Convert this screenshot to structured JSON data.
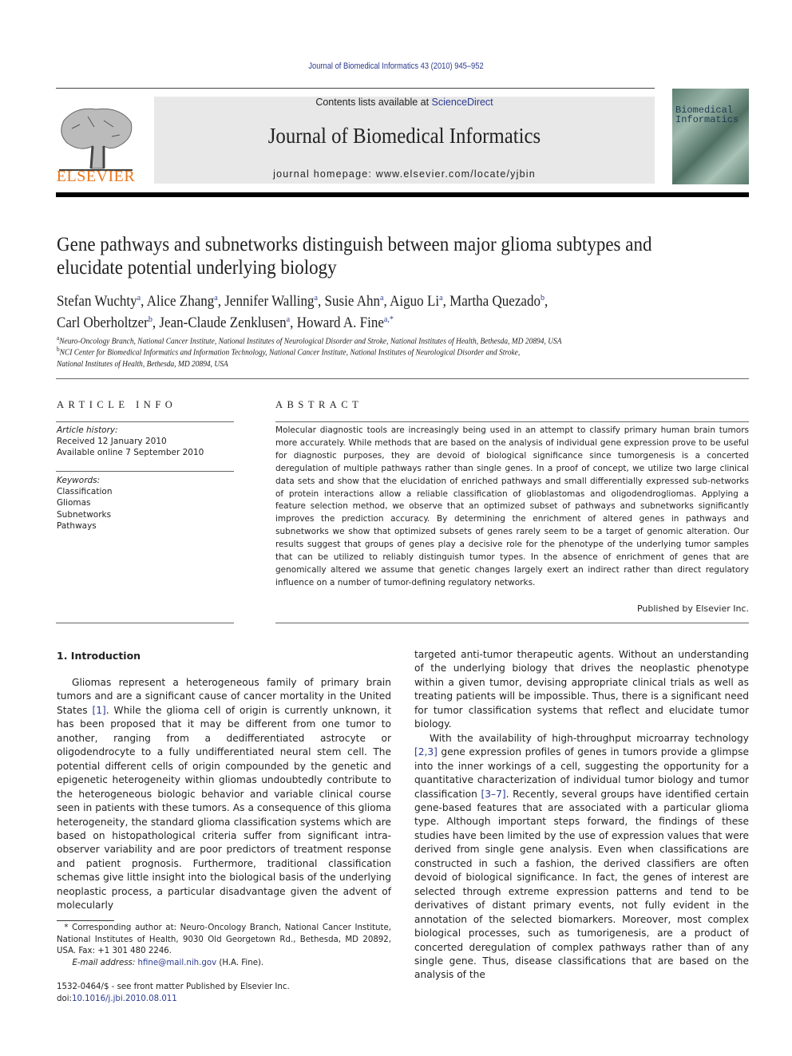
{
  "running_head": "Journal of Biomedical Informatics 43 (2010) 945–952",
  "header": {
    "contents_prefix": "Contents lists available at ",
    "contents_link": "ScienceDirect",
    "journal_title": "Journal of Biomedical Informatics",
    "homepage": "journal homepage: www.elsevier.com/locate/yjbin",
    "publisher_logo_text": "ELSEVIER",
    "cover_text": "Biomedical Informatics",
    "colors": {
      "elsevier_orange": "#e8771e",
      "link_blue": "#2b3a8f",
      "band_gray": "#e8e8e8"
    }
  },
  "article": {
    "title": "Gene pathways and subnetworks distinguish between major glioma subtypes and elucidate potential underlying biology",
    "authors": [
      {
        "name": "Stefan Wuchty",
        "aff": "a"
      },
      {
        "name": "Alice Zhang",
        "aff": "a"
      },
      {
        "name": "Jennifer Walling",
        "aff": "a"
      },
      {
        "name": "Susie Ahn",
        "aff": "a"
      },
      {
        "name": "Aiguo Li",
        "aff": "a"
      },
      {
        "name": "Martha Quezado",
        "aff": "b"
      },
      {
        "name": "Carl Oberholtzer",
        "aff": "b"
      },
      {
        "name": "Jean-Claude Zenklusen",
        "aff": "a"
      },
      {
        "name": "Howard A. Fine",
        "aff": "a,*"
      }
    ],
    "affiliations": [
      {
        "label": "a",
        "text": "Neuro-Oncology Branch, National Cancer Institute, National Institutes of Neurological Disorder and Stroke, National Institutes of Health, Bethesda, MD 20894, USA"
      },
      {
        "label": "b",
        "text": "NCI Center for Biomedical Informatics and Information Technology, National Cancer Institute, National Institutes of Neurological Disorder and Stroke,",
        "text2": "National Institutes of Health, Bethesda, MD 20894, USA"
      }
    ]
  },
  "article_info": {
    "heading": "ARTICLE INFO",
    "history_label": "Article history:",
    "received": "Received 12 January 2010",
    "available": "Available online 7 September 2010",
    "keywords_label": "Keywords:",
    "keywords": [
      "Classification",
      "Gliomas",
      "Subnetworks",
      "Pathways"
    ]
  },
  "abstract": {
    "heading": "ABSTRACT",
    "text": "Molecular diagnostic tools are increasingly being used in an attempt to classify primary human brain tumors more accurately. While methods that are based on the analysis of individual gene expression prove to be useful for diagnostic purposes, they are devoid of biological significance since tumorgenesis is a concerted deregulation of multiple pathways rather than single genes. In a proof of concept, we utilize two large clinical data sets and show that the elucidation of enriched pathways and small differentially expressed sub-networks of protein interactions allow a reliable classification of glioblastomas and oligodendrogliomas. Applying a feature selection method, we observe that an optimized subset of pathways and subnetworks significantly improves the prediction accuracy. By determining the enrichment of altered genes in pathways and subnetworks we show that optimized subsets of genes rarely seem to be a target of genomic alteration. Our results suggest that groups of genes play a decisive role for the phenotype of the underlying tumor samples that can be utilized to reliably distinguish tumor types. In the absence of enrichment of genes that are genomically altered we assume that genetic changes largely exert an indirect rather than direct regulatory influence on a number of tumor-defining regulatory networks.",
    "publisher": "Published by Elsevier Inc."
  },
  "intro": {
    "heading": "1. Introduction",
    "left_p1_a": "Gliomas represent a heterogeneous family of primary brain tumors and are a significant cause of cancer mortality in the United States ",
    "left_p1_ref": "[1]",
    "left_p1_b": ". While the glioma cell of origin is currently unknown, it has been proposed that it may be different from one tumor to another, ranging from a dedifferentiated astrocyte or oligodendrocyte to a fully undifferentiated neural stem cell. The potential different cells of origin compounded by the genetic and epigenetic heterogeneity within gliomas undoubtedly contribute to the heterogeneous biologic behavior and variable clinical course seen in patients with these tumors. As a consequence of this glioma heterogeneity, the standard glioma classification systems which are based on histopathological criteria suffer from significant intra-observer variability and are poor predictors of treatment response and patient prognosis. Furthermore, traditional classification schemas give little insight into the biological basis of the underlying neoplastic process, a particular disadvantage given the advent of molecularly",
    "right_p1": "targeted anti-tumor therapeutic agents. Without an understanding of the underlying biology that drives the neoplastic phenotype within a given tumor, devising appropriate clinical trials as well as treating patients will be impossible. Thus, there is a significant need for tumor classification systems that reflect and elucidate tumor biology.",
    "right_p2_a": "With the availability of high-throughput microarray technology ",
    "right_p2_ref1": "[2,3]",
    "right_p2_b": " gene expression profiles of genes in tumors provide a glimpse into the inner workings of a cell, suggesting the opportunity for a quantitative characterization of individual tumor biology and tumor classification ",
    "right_p2_ref2": "[3–7]",
    "right_p2_c": ". Recently, several groups have identified certain gene-based features that are associated with a particular glioma type. Although important steps forward, the findings of these studies have been limited by the use of expression values that were derived from single gene analysis. Even when classifications are constructed in such a fashion, the derived classifiers are often devoid of biological significance. In fact, the genes of interest are selected through extreme expression patterns and tend to be derivatives of distant primary events, not fully evident in the annotation of the selected biomarkers. Moreover, most complex biological processes, such as tumorigenesis, are a product of concerted deregulation of complex pathways rather than of any single gene. Thus, disease classifications that are based on the analysis of the"
  },
  "footnote": {
    "star": "*",
    "corresponding": " Corresponding author at: Neuro-Oncology Branch, National Cancer Institute, National Institutes of Health, 9030 Old Georgetown Rd., Bethesda, MD 20892, USA. Fax: +1 301 480 2246.",
    "email_label": "E-mail address: ",
    "email": "hfine@mail.nih.gov",
    "email_suffix": " (H.A. Fine).",
    "issn": "1532-0464/$ - see front matter Published by Elsevier Inc.",
    "doi_label": "doi:",
    "doi": "10.1016/j.jbi.2010.08.011"
  }
}
